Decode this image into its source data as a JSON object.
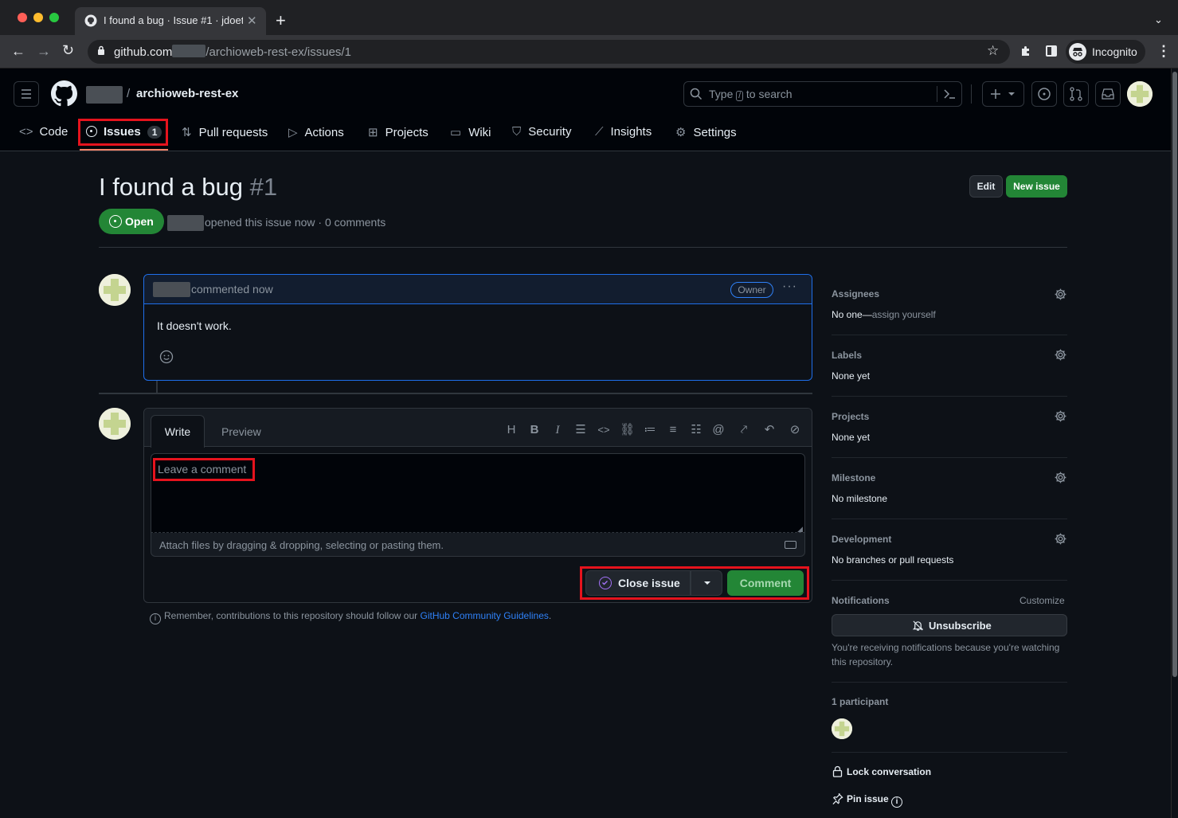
{
  "browser": {
    "tab_title": "I found a bug · Issue #1 · jdoet",
    "url_host": "github.com",
    "url_path": "/archioweb-rest-ex/issues/1",
    "incognito_label": "Incognito"
  },
  "header": {
    "repo_name": "archioweb-rest-ex",
    "search_prefix": "Type",
    "search_key": "/",
    "search_suffix": "to search"
  },
  "nav": {
    "tabs": [
      {
        "label": "Code"
      },
      {
        "label": "Issues",
        "count": "1"
      },
      {
        "label": "Pull requests"
      },
      {
        "label": "Actions"
      },
      {
        "label": "Projects"
      },
      {
        "label": "Wiki"
      },
      {
        "label": "Security"
      },
      {
        "label": "Insights"
      },
      {
        "label": "Settings"
      }
    ]
  },
  "issue": {
    "title": "I found a bug",
    "number": "#1",
    "state": "Open",
    "meta": "opened this issue now · 0 comments",
    "edit_label": "Edit",
    "new_issue_label": "New issue"
  },
  "comment": {
    "meta": "commented now",
    "role_badge": "Owner",
    "body": "It doesn't work."
  },
  "editor": {
    "tab_write": "Write",
    "tab_preview": "Preview",
    "placeholder": "Leave a comment",
    "attach_hint": "Attach files by dragging & dropping, selecting or pasting them.",
    "close_label": "Close issue",
    "comment_label": "Comment",
    "guidelines_prefix": "Remember, contributions to this repository should follow our",
    "guidelines_link": "GitHub Community Guidelines",
    "guidelines_suffix": "."
  },
  "sidebar": {
    "assignees_head": "Assignees",
    "assignees_val_bold": "No one—",
    "assignees_val_link": "assign yourself",
    "labels_head": "Labels",
    "labels_val": "None yet",
    "projects_head": "Projects",
    "projects_val": "None yet",
    "milestone_head": "Milestone",
    "milestone_val": "No milestone",
    "development_head": "Development",
    "development_val": "No branches or pull requests",
    "notifications_head": "Notifications",
    "customize_label": "Customize",
    "unsubscribe_label": "Unsubscribe",
    "notif_reason": "You're receiving notifications because you're watching this repository.",
    "participants_head": "1 participant",
    "lock_label": "Lock conversation",
    "pin_label": "Pin issue"
  },
  "colors": {
    "accent_green": "#238636",
    "link_blue": "#2f81f7",
    "highlight_red": "#e5131d"
  }
}
